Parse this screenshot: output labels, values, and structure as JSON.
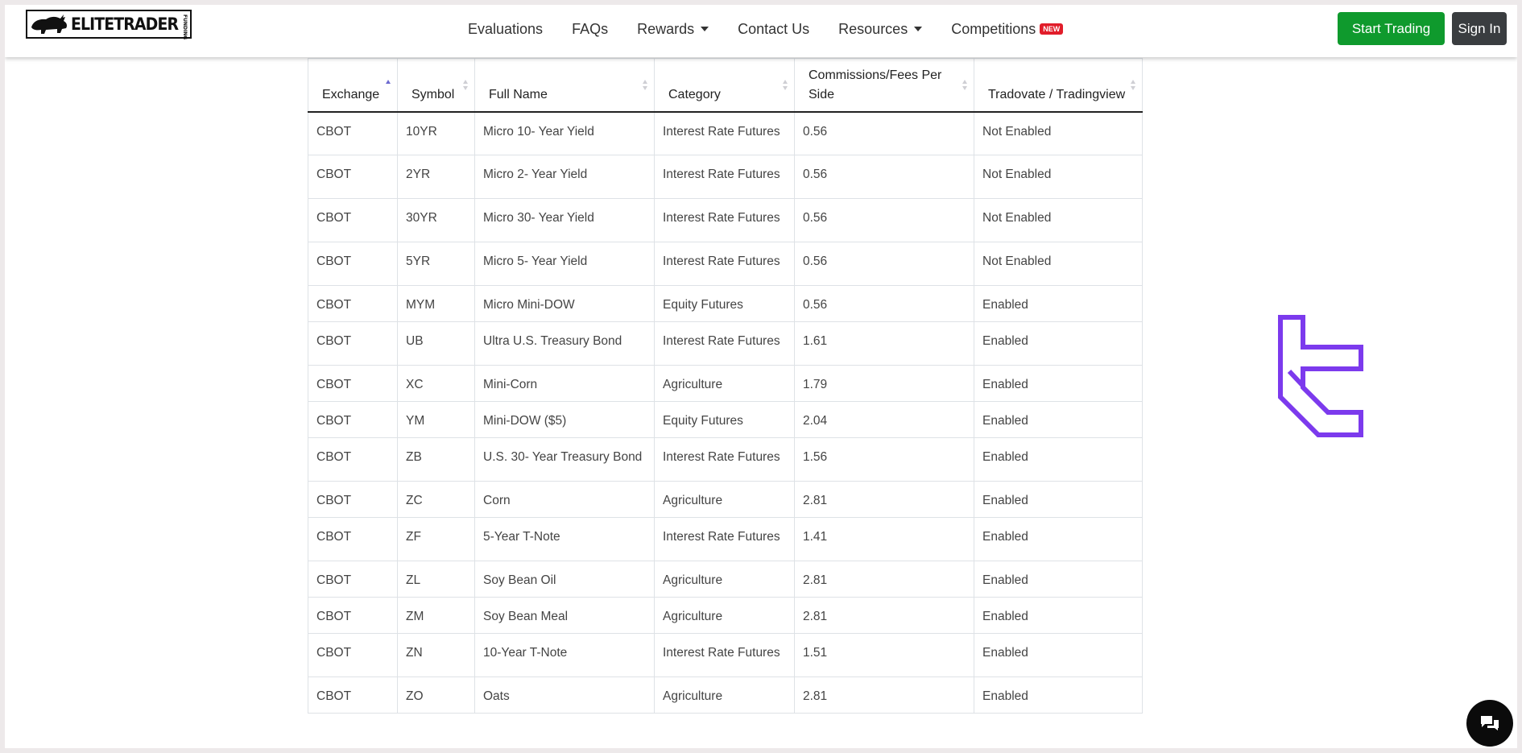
{
  "brand": {
    "logo_text": "ELITETRADER",
    "logo_side_text": "FUNDING",
    "brand_colors": {
      "green": "#0f9a2d",
      "dark": "#3a3d40",
      "new_badge": "#e11d2a",
      "purple_mark": "#7c3aed"
    }
  },
  "nav": {
    "items": [
      {
        "label": "Evaluations",
        "dropdown": false
      },
      {
        "label": "FAQs",
        "dropdown": false
      },
      {
        "label": "Rewards",
        "dropdown": true
      },
      {
        "label": "Contact Us",
        "dropdown": false
      },
      {
        "label": "Resources",
        "dropdown": true
      },
      {
        "label": "Competitions",
        "dropdown": false,
        "badge": "NEW"
      }
    ],
    "start_trading": "Start Trading",
    "sign_in": "Sign In"
  },
  "table": {
    "headers": [
      "Exchange",
      "Symbol",
      "Full Name",
      "Category",
      "Commissions/Fees Per Side",
      "Tradovate / Tradingview"
    ],
    "sorted_column": "Exchange",
    "rows": [
      [
        "CBOT",
        "10YR",
        "Micro 10- Year Yield",
        "Interest Rate Futures",
        "0.56",
        "Not Enabled"
      ],
      [
        "CBOT",
        "2YR",
        "Micro 2- Year Yield",
        "Interest Rate Futures",
        "0.56",
        "Not Enabled"
      ],
      [
        "CBOT",
        "30YR",
        "Micro 30- Year Yield",
        "Interest Rate Futures",
        "0.56",
        "Not Enabled"
      ],
      [
        "CBOT",
        "5YR",
        "Micro 5- Year Yield",
        "Interest Rate Futures",
        "0.56",
        "Not Enabled"
      ],
      [
        "CBOT",
        "MYM",
        "Micro Mini-DOW",
        "Equity Futures",
        "0.56",
        "Enabled"
      ],
      [
        "CBOT",
        "UB",
        "Ultra U.S. Treasury Bond",
        "Interest Rate Futures",
        "1.61",
        "Enabled"
      ],
      [
        "CBOT",
        "XC",
        "Mini-Corn",
        "Agriculture",
        "1.79",
        "Enabled"
      ],
      [
        "CBOT",
        "YM",
        "Mini-DOW ($5)",
        "Equity Futures",
        "2.04",
        "Enabled"
      ],
      [
        "CBOT",
        "ZB",
        "U.S. 30- Year Treasury Bond",
        "Interest Rate Futures",
        "1.56",
        "Enabled"
      ],
      [
        "CBOT",
        "ZC",
        "Corn",
        "Agriculture",
        "2.81",
        "Enabled"
      ],
      [
        "CBOT",
        "ZF",
        "5-Year T-Note",
        "Interest Rate Futures",
        "1.41",
        "Enabled"
      ],
      [
        "CBOT",
        "ZL",
        "Soy Bean Oil",
        "Agriculture",
        "2.81",
        "Enabled"
      ],
      [
        "CBOT",
        "ZM",
        "Soy Bean Meal",
        "Agriculture",
        "2.81",
        "Enabled"
      ],
      [
        "CBOT",
        "ZN",
        "10-Year T-Note",
        "Interest Rate Futures",
        "1.51",
        "Enabled"
      ],
      [
        "CBOT",
        "ZO",
        "Oats",
        "Agriculture",
        "2.81",
        "Enabled"
      ]
    ]
  },
  "icons": {
    "watermark": "tradingfinder-logo-icon",
    "chat": "chat-bubble-icon",
    "logo_animal": "bull-icon"
  }
}
